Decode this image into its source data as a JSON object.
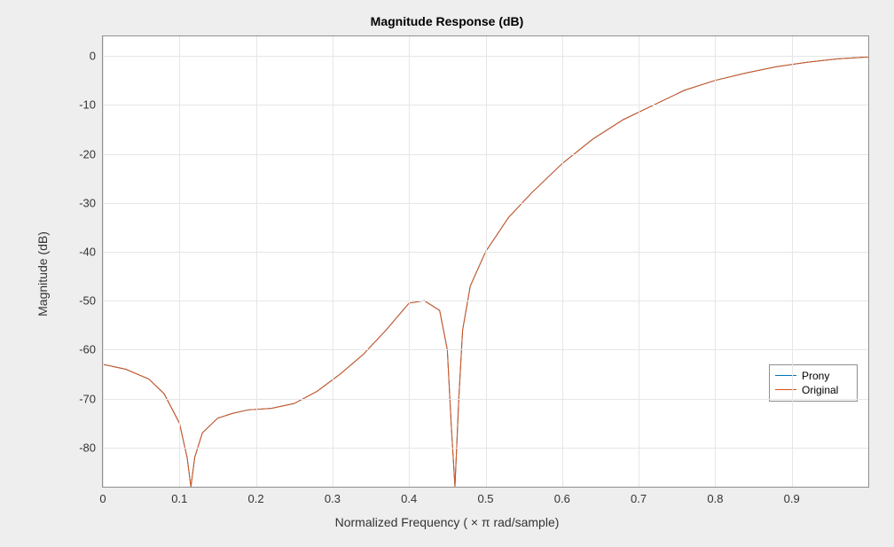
{
  "chart_data": {
    "type": "line",
    "title": "Magnitude Response (dB)",
    "xlabel": "Normalized  Frequency  ( × π  rad/sample)",
    "ylabel": "Magnitude (dB)",
    "xlim": [
      0,
      1
    ],
    "ylim": [
      -88,
      4
    ],
    "xticks": [
      0,
      0.1,
      0.2,
      0.3,
      0.4,
      0.5,
      0.6,
      0.7,
      0.8,
      0.9
    ],
    "yticks": [
      -80,
      -70,
      -60,
      -50,
      -40,
      -30,
      -20,
      -10,
      0
    ],
    "grid": true,
    "series": [
      {
        "name": "Prony",
        "color": "#0072BD",
        "x": [
          0,
          0.03,
          0.06,
          0.08,
          0.1,
          0.11,
          0.115,
          0.12,
          0.13,
          0.15,
          0.17,
          0.19,
          0.22,
          0.25,
          0.28,
          0.31,
          0.34,
          0.37,
          0.4,
          0.42,
          0.44,
          0.45,
          0.455,
          0.46,
          0.465,
          0.47,
          0.48,
          0.5,
          0.53,
          0.56,
          0.6,
          0.64,
          0.68,
          0.72,
          0.76,
          0.8,
          0.84,
          0.88,
          0.92,
          0.96,
          1.0
        ],
        "y": [
          -63,
          -64,
          -66,
          -69,
          -75,
          -82,
          -88,
          -82,
          -77,
          -74,
          -73,
          -72.3,
          -72,
          -71,
          -68.5,
          -65,
          -61,
          -56,
          -50.5,
          -50,
          -52,
          -60,
          -75,
          -88,
          -70,
          -56,
          -47,
          -40,
          -33,
          -28,
          -22,
          -17,
          -13,
          -10,
          -7,
          -5,
          -3.5,
          -2.2,
          -1.3,
          -0.6,
          -0.2
        ]
      },
      {
        "name": "Original",
        "color": "#D95319",
        "x": [
          0,
          0.03,
          0.06,
          0.08,
          0.1,
          0.11,
          0.115,
          0.12,
          0.13,
          0.15,
          0.17,
          0.19,
          0.22,
          0.25,
          0.28,
          0.31,
          0.34,
          0.37,
          0.4,
          0.42,
          0.44,
          0.45,
          0.455,
          0.46,
          0.465,
          0.47,
          0.48,
          0.5,
          0.53,
          0.56,
          0.6,
          0.64,
          0.68,
          0.72,
          0.76,
          0.8,
          0.84,
          0.88,
          0.92,
          0.96,
          1.0
        ],
        "y": [
          -63,
          -64,
          -66,
          -69,
          -75,
          -82,
          -88,
          -82,
          -77,
          -74,
          -73,
          -72.3,
          -72,
          -71,
          -68.5,
          -65,
          -61,
          -56,
          -50.5,
          -50,
          -52,
          -60,
          -75,
          -88,
          -70,
          -56,
          -47,
          -40,
          -33,
          -28,
          -22,
          -17,
          -13,
          -10,
          -7,
          -5,
          -3.5,
          -2.2,
          -1.3,
          -0.6,
          -0.2
        ]
      }
    ],
    "legend_position": "right"
  },
  "legend": {
    "items": [
      {
        "label": "Prony",
        "color": "#0072BD"
      },
      {
        "label": "Original",
        "color": "#D95319"
      }
    ]
  }
}
